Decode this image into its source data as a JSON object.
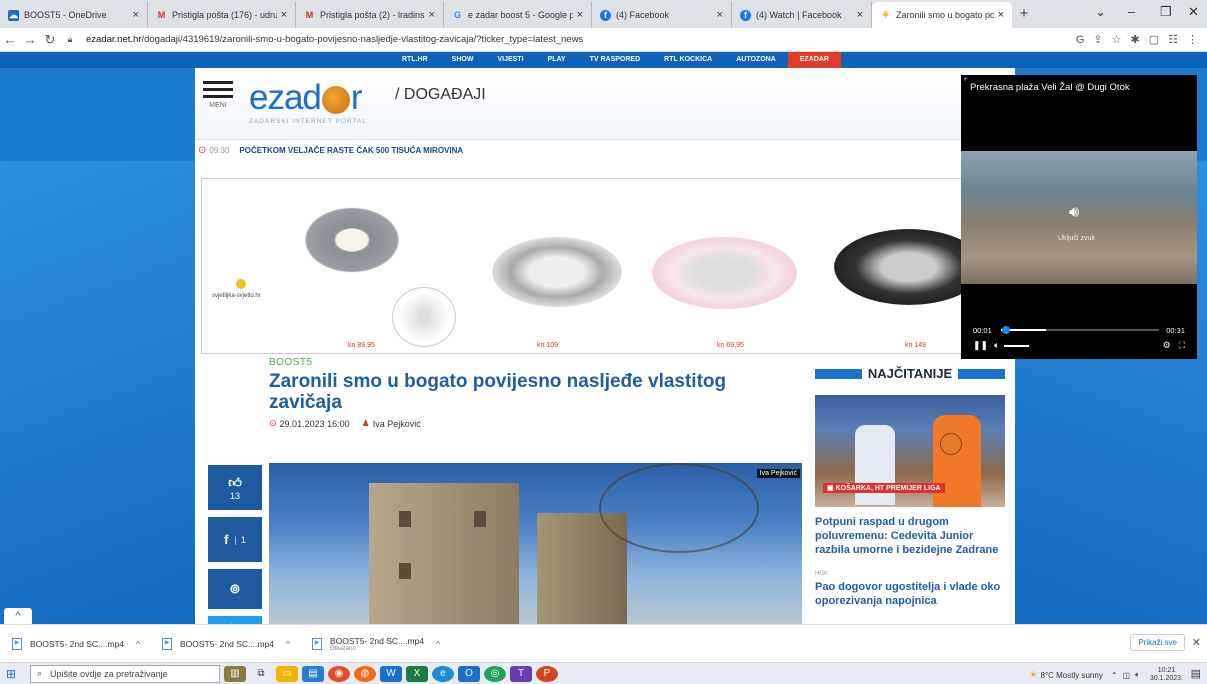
{
  "tabs": [
    {
      "title": "BOOST5 - OneDrive",
      "icon": "onedrive-icon",
      "color": "#1a6fcc"
    },
    {
      "title": "Pristigla pošta (176) - udrugazo",
      "icon": "gmail-icon",
      "color": "#d93025"
    },
    {
      "title": "Pristigla pošta (2) - lradinski@g",
      "icon": "gmail-icon",
      "color": "#d93025"
    },
    {
      "title": "e zadar boost 5 - Google pretra",
      "icon": "google-icon",
      "color": "#4285f4"
    },
    {
      "title": "(4) Facebook",
      "icon": "facebook-icon",
      "color": "#1877f2"
    },
    {
      "title": "(4) Watch | Facebook",
      "icon": "facebook-icon",
      "color": "#1877f2"
    },
    {
      "title": "Zaronili smo u bogato povijesno",
      "icon": "ezadar-icon",
      "color": "#f0a020"
    }
  ],
  "address": {
    "domain": "ezadar.net.hr",
    "path": "/dogadaji/4319619/zaronili-smo-u-bogato-povijesno-nasljedje-vlastitog-zavicaja/?ticker_type=latest_news"
  },
  "topnav": [
    "RTL.HR",
    "SHOW",
    "VIJESTI",
    "PLAY",
    "TV RASPORED",
    "RTL KOCKICA",
    "AUTOZONA",
    "EZADAR"
  ],
  "header": {
    "menu_label": "MENI",
    "logo_pre": "ezad",
    "logo_post": "r",
    "logo_sub": "ZADARSKI INTERNET PORTAL",
    "section": "/ DOGAĐAJI"
  },
  "ticker": {
    "time": "09:30",
    "headline": "POČETKOM VELJAČE RASTE ČAK 500 TISUĆA MIROVINA"
  },
  "ad": {
    "brand": "svjetiljka-svjetlo.hr",
    "prices": [
      "kn 89,95",
      "kn 109",
      "kn 69,95",
      "kn 149"
    ]
  },
  "article": {
    "kicker": "BOOST5",
    "title": "Zaronili smo u bogato povijesno nasljeđe vlastitog zavičaja",
    "date": "29.01.2023 16:00",
    "author": "Iva Pejković",
    "photo_credit": "Iva Pejković"
  },
  "share": {
    "likes": "13",
    "fb_count": "1"
  },
  "sidebar": {
    "heading": "NAJČITANIJE",
    "tag": "KOŠARKA, HT PREMIJER LIGA",
    "story1": "Potpuni raspad u drugom poluvremenu: Cedevita Junior razbila umorne i bezidejne Zadrane",
    "category2": "HGK",
    "story2": "Pao dogovor ugostitelja i vlade oko oporezivanja napojnica"
  },
  "video": {
    "title": "Prekrasna plaža Veli Žal @ Dugi Otok",
    "unmute": "Uključi zvuk",
    "time_current": "00:01",
    "time_total": "00:31",
    "progress": 0.03
  },
  "downloads": [
    {
      "name": "BOOST5- 2nd SC....mp4",
      "status": ""
    },
    {
      "name": "BOOST5- 2nd SC....mp4",
      "status": ""
    },
    {
      "name": "BOOST5- 2nd SC....mp4",
      "status": "Otkazano"
    }
  ],
  "downloads_show_all": "Prikaži sve",
  "taskbar": {
    "search_placeholder": "Upišite ovdje za pretraživanje",
    "weather": "8°C  Mostly sunny",
    "time": "10:21",
    "date": "30.1.2023."
  }
}
